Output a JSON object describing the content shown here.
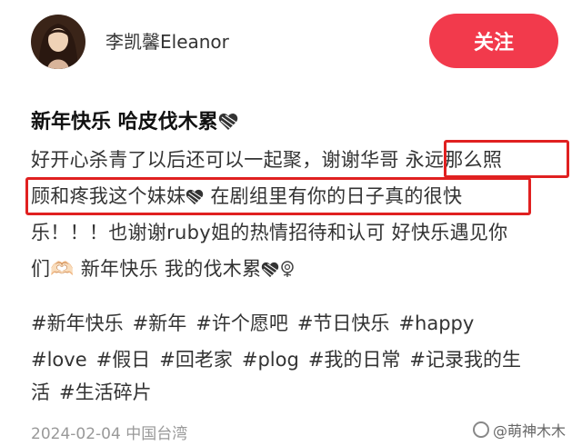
{
  "user": {
    "name": "李凯馨Eleanor",
    "follow_label": "关注"
  },
  "post": {
    "title": "新年快乐 哈皮伐木累",
    "lines": [
      "好开心杀青了以后还可以一起聚，谢谢华哥 永远那么照",
      "顾和疼我这个妹妹",
      " 在剧组里有你的日子真的很快",
      "乐！！！也谢谢ruby姐的热情招待和认可 好快乐遇见你",
      "们🫶🏻 新年快乐 我的伐木累"
    ],
    "tags_line1": [
      "#新年快乐",
      "#新年",
      "#许个愿吧",
      "#节日快乐",
      "#happy"
    ],
    "tags_line2": [
      "#love",
      "#假日",
      "#回老家",
      "#plog",
      "#我的日常",
      "#记录我的生"
    ],
    "tags_line3": [
      "活",
      "#生活碎片"
    ]
  },
  "footer": {
    "date": "2024-02-04",
    "location": "中国台湾"
  },
  "watermark": {
    "text": "@萌神木木"
  },
  "colors": {
    "follow_bg": "#f23a4c",
    "highlight": "#e02020"
  }
}
